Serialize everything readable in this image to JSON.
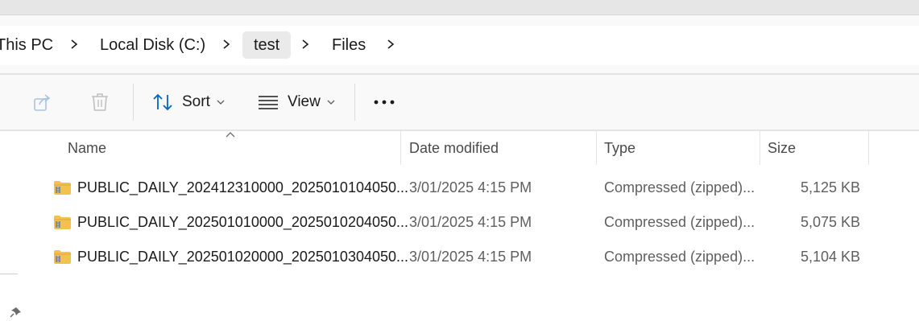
{
  "breadcrumb": {
    "items": [
      "This PC",
      "Local Disk (C:)",
      "test",
      "Files"
    ]
  },
  "toolbar": {
    "sort_label": "Sort",
    "view_label": "View"
  },
  "table": {
    "headers": {
      "name": "Name",
      "date": "Date modified",
      "type": "Type",
      "size": "Size"
    },
    "rows": [
      {
        "name": "PUBLIC_DAILY_202412310000_2025010104050...",
        "date": "3/01/2025 4:15 PM",
        "type": "Compressed (zipped)...",
        "size": "5,125 KB"
      },
      {
        "name": "PUBLIC_DAILY_202501010000_2025010204050...",
        "date": "3/01/2025 4:15 PM",
        "type": "Compressed (zipped)...",
        "size": "5,075 KB"
      },
      {
        "name": "PUBLIC_DAILY_202501020000_2025010304050...",
        "date": "3/01/2025 4:15 PM",
        "type": "Compressed (zipped)...",
        "size": "5,104 KB"
      }
    ]
  },
  "icons": {
    "share": "share-icon",
    "delete": "trash-icon",
    "sort": "sort-icon",
    "view": "view-icon",
    "more": "more-icon",
    "file": "zip-folder-icon",
    "pin": "pin-icon"
  },
  "colors": {
    "accent": "#0067c0",
    "folder": "#f2c14e"
  }
}
